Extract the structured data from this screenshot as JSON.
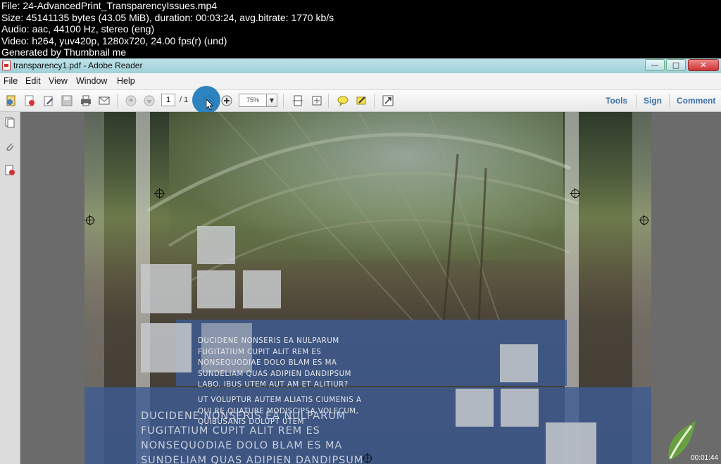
{
  "meta_lines": [
    "File: 24-AdvancedPrint_TransparencyIssues.mp4",
    "Size: 45141135 bytes (43.05 MiB), duration: 00:03:24, avg.bitrate: 1770 kb/s",
    "Audio: aac, 44100 Hz, stereo (eng)",
    "Video: h264, yuv420p, 1280x720, 24.00 fps(r) (und)",
    "Generated by Thumbnail me"
  ],
  "window": {
    "title": "transparency1.pdf - Adobe Reader",
    "minimize_label": "—",
    "maximize_label": "□",
    "close_label": "✕"
  },
  "menu": [
    "File",
    "Edit",
    "View",
    "Window",
    "Help"
  ],
  "toolbar": {
    "page_current": "1",
    "page_total": "/ 1",
    "zoom_value": "75%",
    "zoom_dropdown": "▼",
    "tools_label": "Tools",
    "sign_label": "Sign",
    "comment_label": "Comment"
  },
  "icons": [
    "create-pdf-icon",
    "open-icon",
    "edit-icon",
    "save-icon",
    "print-icon",
    "email-icon",
    "prev-page-icon",
    "next-page-icon",
    "zoom-out-icon",
    "zoom-in-icon",
    "fit-page-icon",
    "fit-width-icon",
    "comment-icon",
    "highlight-icon",
    "fullscreen-icon",
    "pages-panel-icon",
    "attachments-icon",
    "signatures-icon"
  ],
  "colors": {
    "accent": "#3a6fa8",
    "doc_blue": "#3d5c93",
    "cursor_highlight": "#1c7ab8"
  },
  "document": {
    "body_lines": [
      "DUCIDENE NONSERIS EA NULPARUM",
      "FUGITATIUM CUPIT ALIT REM ES",
      "NONSEQUODIAE DOLO BLAM ES MA",
      "SUNDELIAM QUAS ADIPIEN DANDIPSUM",
      "LABO. IBUS UTEM AUT AM ET ALITIUR?"
    ],
    "body2_lines": [
      "UT VOLUPTUR AUTEM ALIATIS CIUMENIS A",
      "QUI RE QUATURE MODISCIPSA VOLECUM,",
      "QUIBUSANIS DOLUPT UTEM"
    ],
    "big_lines": [
      "DUCIDENE NONSERIS EA NULPARUM",
      "FUGITATIUM CUPIT ALIT REM ES",
      "NONSEQUODIAE DOLO BLAM ES MA",
      "SUNDELIAM QUAS ADIPIEN DANDIPSUM"
    ]
  },
  "timestamp": "00:01:44"
}
